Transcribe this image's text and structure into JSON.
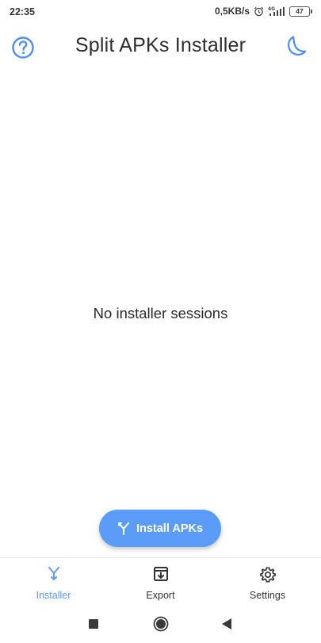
{
  "status_bar": {
    "time": "22:35",
    "net_speed": "0,5KB/s",
    "network_type": "4G",
    "battery": "47",
    "icons": [
      "alarm-icon",
      "signal-icon",
      "battery-icon"
    ]
  },
  "app_bar": {
    "title": "Split APKs Installer",
    "help_icon": "help-circle-icon",
    "theme_icon": "moon-icon"
  },
  "main": {
    "empty_message": "No installer sessions"
  },
  "fab": {
    "label": "Install APKs",
    "icon": "split-arrow-icon"
  },
  "bottom_nav": {
    "items": [
      {
        "label": "Installer",
        "icon": "installer-icon",
        "active": true
      },
      {
        "label": "Export",
        "icon": "export-icon",
        "active": false
      },
      {
        "label": "Settings",
        "icon": "settings-gear-icon",
        "active": false
      }
    ]
  },
  "system_nav": {
    "buttons": [
      "recents-icon",
      "home-icon",
      "back-icon"
    ]
  },
  "colors": {
    "accent": "#5a9cf8",
    "text": "#2b2b2b",
    "background": "#ffffff"
  }
}
